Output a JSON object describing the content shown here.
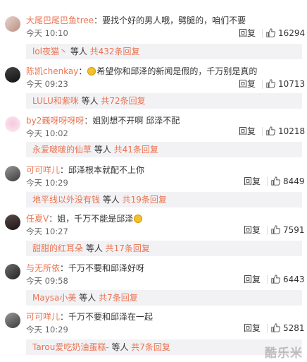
{
  "colors": {
    "accent": "#eb7350",
    "text": "#333333",
    "muted": "#666666",
    "sub_bg": "#f2f2f5"
  },
  "icons": {
    "like": "thumbs-up-icon",
    "emoji": "smile-emoji-icon"
  },
  "labels": {
    "reply": "回复",
    "colon": "：",
    "etc": " 等人 "
  },
  "comments": [
    {
      "user": "大尾巴尾巴鱼tree",
      "text": "要找个好的男人哦，劈腿的，咱们不要",
      "time": "今天 10:10",
      "likes": "16294",
      "sub_user": "lol夜猫丶",
      "sub_total": "共432条回复"
    },
    {
      "user": "陈凯chenkay",
      "text": "希望你和邱泽的新闻是假的，千万别是真的",
      "time": "今天 09:23",
      "likes": "10713",
      "sub_user": "LULU和紫咪",
      "sub_total": "共72条回复"
    },
    {
      "user": "by2巍呀呀呀呀",
      "text": "姐别想不开啊 邱泽不配",
      "time": "今天 10:02",
      "likes": "10218",
      "sub_user": "永爱啵啵的仙草",
      "sub_total": "共41条回复"
    },
    {
      "user": "可可咩儿",
      "text": "邱泽根本就配不上你",
      "time": "今天 10:29",
      "likes": "8449",
      "sub_user": "地平线以外没有钱",
      "sub_total": "共19条回复"
    },
    {
      "user": "任夏V",
      "text": "姐，千万不能是邱泽",
      "time": "今天 10:27",
      "likes": "7591",
      "sub_user": "甜甜的红耳朵",
      "sub_total": "共17条回复"
    },
    {
      "user": "与无所依",
      "text": "千万不要和邱泽好呀",
      "time": "今天 09:58",
      "likes": "6443",
      "sub_user": "Maysa小美",
      "sub_total": "共7条回复"
    },
    {
      "user": "可可咩儿",
      "text": "千万不要和邱泽在一起",
      "time": "今天 10:29",
      "likes": "5281",
      "sub_user": "Tarou爱吃奶油蛋糕-",
      "sub_total": "共7条回复"
    }
  ],
  "watermark": "酷乐米"
}
